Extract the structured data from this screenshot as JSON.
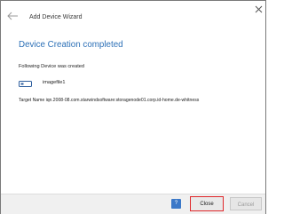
{
  "window": {
    "title": "Add Device Wizard"
  },
  "content": {
    "heading": "Device Creation completed",
    "subtitle": "Following Device was created",
    "device_name": "imagefile1",
    "target_name": "Target Name iqn.2008-08.com.starwindsoftware:storagenode01.corp.id-home.de-whitness"
  },
  "footer": {
    "help_label": "?",
    "close_label": "Close",
    "cancel_label": "Cancel"
  },
  "icons": {
    "back": "arrow-left-icon",
    "window_close": "close-icon",
    "device": "disk-device-icon"
  },
  "colors": {
    "heading": "#2b6fb6",
    "help_button": "#3b78c8",
    "close_highlight": "#e0272b"
  }
}
